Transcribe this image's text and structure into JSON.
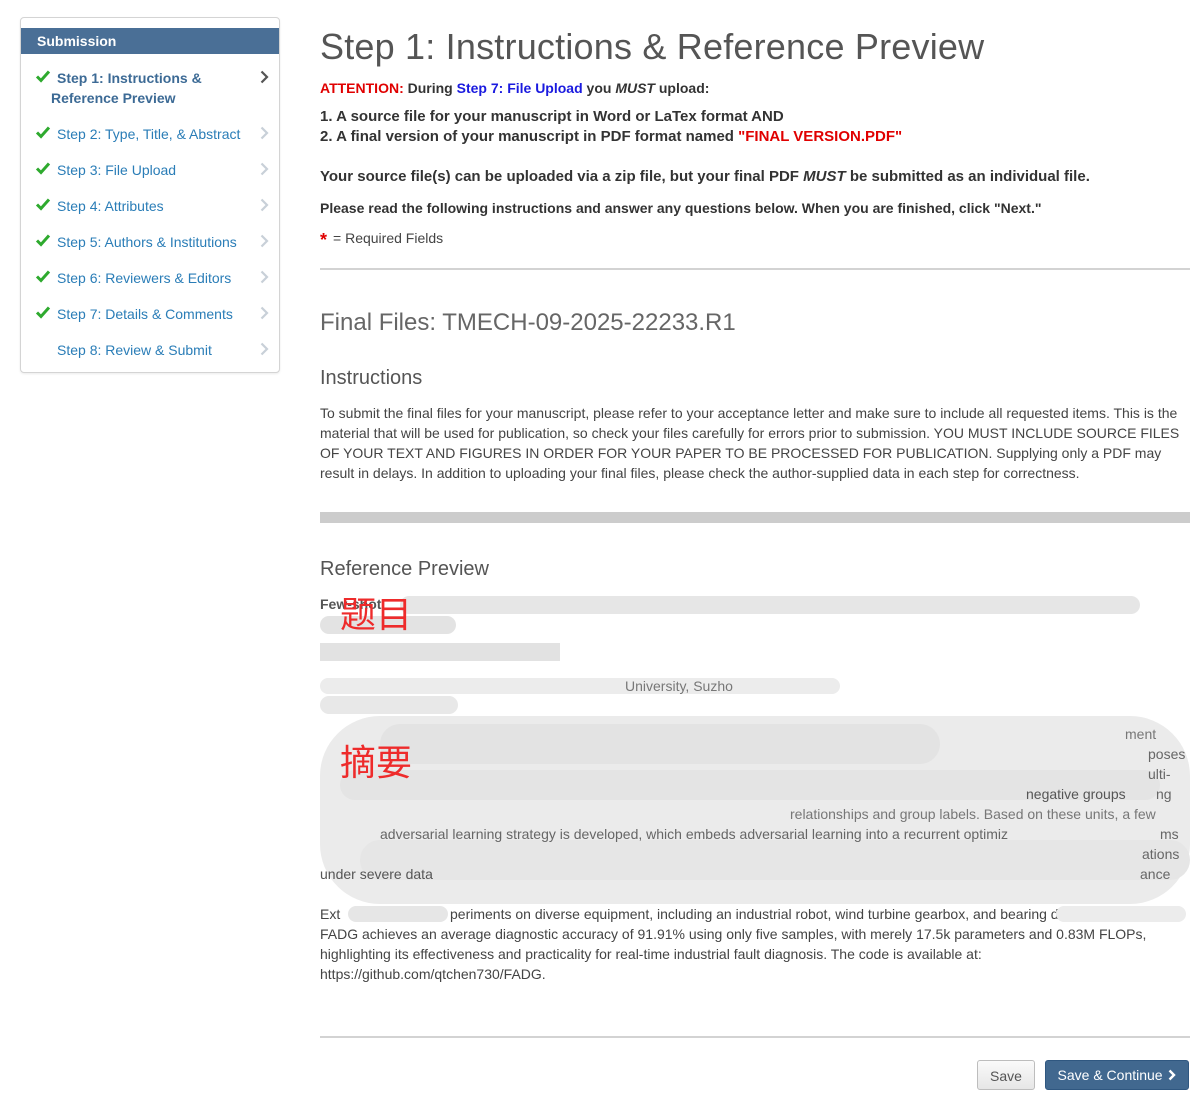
{
  "sidebar": {
    "header": "Submission",
    "items": [
      {
        "label_line1": "Step 1: Instructions &",
        "label_line2": "Reference Preview",
        "done": true,
        "active": true
      },
      {
        "label": "Step 2: Type, Title, & Abstract",
        "done": true
      },
      {
        "label": "Step 3: File Upload",
        "done": true
      },
      {
        "label": "Step 4: Attributes",
        "done": true
      },
      {
        "label": "Step 5: Authors & Institutions",
        "done": true
      },
      {
        "label": "Step 6: Reviewers & Editors",
        "done": true
      },
      {
        "label": "Step 7: Details & Comments",
        "done": true
      },
      {
        "label": "Step 8: Review & Submit",
        "done": false
      }
    ]
  },
  "main": {
    "title": "Step 1: Instructions & Reference Preview",
    "attention": {
      "label": "ATTENTION:",
      "during": "During",
      "step_link": "Step 7: File Upload",
      "you": "you",
      "must": "MUST",
      "upload": "upload:"
    },
    "list": {
      "item1": "1. A source file for your manuscript in Word or LaTex format AND",
      "item2_prefix": "2. A final version of your manuscript in PDF format named",
      "item2_name": "\"FINAL VERSION.PDF\""
    },
    "zip_note": {
      "before": "Your source file(s) can be uploaded via a zip file, but your final PDF",
      "must": "MUST",
      "after": "be submitted as an individual file."
    },
    "instructions_note": "Please read the following instructions and answer any questions below. When you are finished, click \"Next.\"",
    "required": {
      "star": "*",
      "text": "= Required Fields"
    },
    "final_files_title": "Final Files: TMECH-09-2025-22233.R1",
    "instructions_heading": "Instructions",
    "instructions_body": "To submit the final files for your manuscript, please refer to your acceptance letter and make sure to include all requested items. This is the material that will be used for publication, so check your files carefully for errors prior to submission. YOU MUST INCLUDE SOURCE FILES OF YOUR TEXT AND FIGURES IN ORDER FOR YOUR PAPER TO BE PROCESSED FOR PUBLICATION. Supplying only a PDF may result in delays. In addition to uploading your final files, please check the author-supplied data in each step for correctness.",
    "reference_heading": "Reference Preview",
    "annotation_title": "题目",
    "annotation_abstract": "摘要",
    "ref_fragments": {
      "few_shot": "Few-shot",
      "university": "University, Suzho",
      "negative_groups": "negative groups",
      "relationships": "relationships and group labels. Based on these units, a few",
      "adversarial": "adversarial learning strategy is developed, which embeds adversarial learning into a recurrent optimiz",
      "under_severe": "under severe data",
      "ment": "ment",
      "poses": "poses",
      "ulti": "ulti-",
      "ng": "ng",
      "ms": "ms",
      "ations": "ations",
      "ance": "ance",
      "extensive": "Ext",
      "experiments": "periments on diverse equipment, including an industrial robot, wind turbine gearbox, and bearing datasets,",
      "line2": "FADG achieves an average diagnostic accuracy of 91.91% using only five samples, with merely 17.5k parameters and 0.83M FLOPs,",
      "line3": "highlighting its effectiveness and practicality for real-time industrial fault diagnosis. The code is available at:",
      "line4": "https://github.com/qtchen730/FADG."
    },
    "buttons": {
      "save": "Save",
      "save_continue": "Save & Continue"
    }
  },
  "colors": {
    "sidebar_header": "#4a6f96",
    "link": "#2a7db7",
    "check": "#2eaa2e",
    "attention": "#e00000",
    "step_link": "#1a1adf",
    "primary_button": "#41688f"
  }
}
